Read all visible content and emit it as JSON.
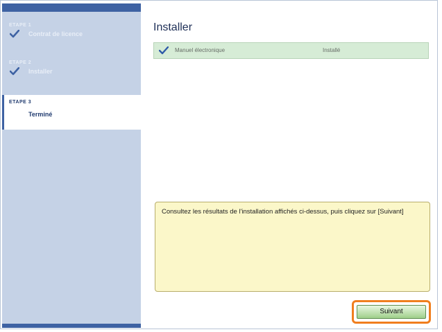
{
  "sidebar": {
    "steps": [
      {
        "num": "ETAPE 1",
        "label": "Contrat de licence",
        "state": "done"
      },
      {
        "num": "ETAPE 2",
        "label": "Installer",
        "state": "done"
      },
      {
        "num": "ETAPE 3",
        "label": "Terminé",
        "state": "current"
      }
    ]
  },
  "main": {
    "title": "Installer",
    "results": [
      {
        "name": "Manuel électronique",
        "status": "Installé"
      }
    ],
    "message": "Consultez les résultats de l'installation affichés ci-dessus, puis cliquez sur [Suivant]",
    "next_label": "Suivant"
  },
  "colors": {
    "sidebar_bg": "#c5d2e6",
    "sidebar_accent": "#3e62a3",
    "result_row_bg": "#d6ecd6",
    "message_bg": "#fbf7c9",
    "highlight": "#f07e1e",
    "button_green": "#9fcf8a"
  }
}
